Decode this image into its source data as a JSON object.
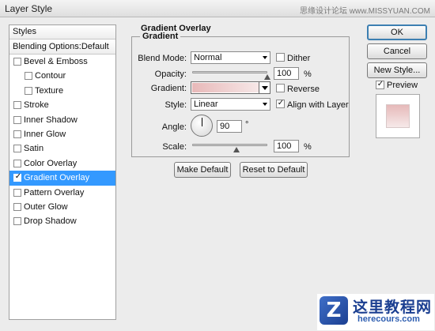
{
  "window": {
    "title": "Layer Style",
    "watermark": "思缘设计论坛 www.MISSYUAN.COM"
  },
  "sidebar": {
    "header": "Styles",
    "blending": "Blending Options:Default",
    "items": [
      {
        "label": "Bevel & Emboss",
        "checked": false
      },
      {
        "label": "Contour",
        "checked": false
      },
      {
        "label": "Texture",
        "checked": false
      },
      {
        "label": "Stroke",
        "checked": false
      },
      {
        "label": "Inner Shadow",
        "checked": false
      },
      {
        "label": "Inner Glow",
        "checked": false
      },
      {
        "label": "Satin",
        "checked": false
      },
      {
        "label": "Color Overlay",
        "checked": false
      },
      {
        "label": "Gradient Overlay",
        "checked": true
      },
      {
        "label": "Pattern Overlay",
        "checked": false
      },
      {
        "label": "Outer Glow",
        "checked": false
      },
      {
        "label": "Drop Shadow",
        "checked": false
      }
    ]
  },
  "panel": {
    "section_title": "Gradient Overlay",
    "group_title": "Gradient",
    "blend_mode_label": "Blend Mode:",
    "blend_mode_value": "Normal",
    "dither_label": "Dither",
    "dither_checked": false,
    "opacity_label": "Opacity:",
    "opacity_value": "100",
    "opacity_unit": "%",
    "gradient_label": "Gradient:",
    "gradient_colors": [
      "#e8b9b9",
      "#f6e7e7"
    ],
    "reverse_label": "Reverse",
    "reverse_checked": false,
    "style_label": "Style:",
    "style_value": "Linear",
    "align_label": "Align with Layer",
    "align_checked": true,
    "angle_label": "Angle:",
    "angle_value": "90",
    "angle_unit": "°",
    "scale_label": "Scale:",
    "scale_value": "100",
    "scale_unit": "%",
    "make_default": "Make Default",
    "reset_default": "Reset to Default"
  },
  "buttons": {
    "ok": "OK",
    "cancel": "Cancel",
    "new_style": "New Style...",
    "preview_label": "Preview",
    "preview_checked": true
  },
  "logo": {
    "mark": "Z",
    "name": "这里教程网",
    "site": "herecours.com"
  }
}
